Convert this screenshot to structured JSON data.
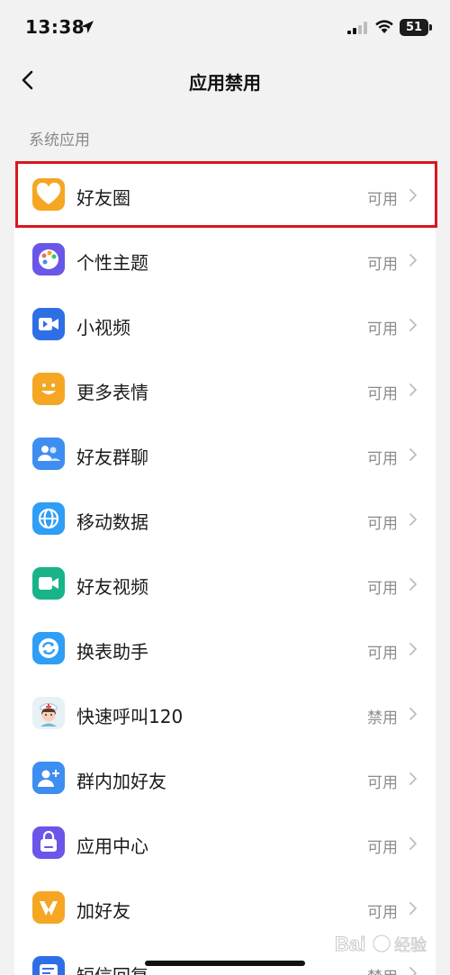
{
  "status_bar": {
    "time": "13:38",
    "battery": "51"
  },
  "nav": {
    "title": "应用禁用"
  },
  "section": {
    "header": "系统应用"
  },
  "apps": [
    {
      "name": "好友圈",
      "status": "可用",
      "icon": "heart-icon",
      "color": "#f5a623"
    },
    {
      "name": "个性主题",
      "status": "可用",
      "icon": "palette-icon",
      "color": "#6a56e8"
    },
    {
      "name": "小视频",
      "status": "可用",
      "icon": "video-camera-icon",
      "color": "#2f6fe6"
    },
    {
      "name": "更多表情",
      "status": "可用",
      "icon": "smiley-icon",
      "color": "#f5a623"
    },
    {
      "name": "好友群聊",
      "status": "可用",
      "icon": "group-chat-icon",
      "color": "#3d8ef0"
    },
    {
      "name": "移动数据",
      "status": "可用",
      "icon": "globe-icon",
      "color": "#2f9ef5"
    },
    {
      "name": "好友视频",
      "status": "可用",
      "icon": "video-call-icon",
      "color": "#19b38a"
    },
    {
      "name": "换表助手",
      "status": "可用",
      "icon": "sync-icon",
      "color": "#2f9ef5"
    },
    {
      "name": "快速呼叫120",
      "status": "禁用",
      "icon": "nurse-icon",
      "color": "#e7f1f6"
    },
    {
      "name": "群内加好友",
      "status": "可用",
      "icon": "add-friend-icon",
      "color": "#3d8ef0"
    },
    {
      "name": "应用中心",
      "status": "可用",
      "icon": "shopping-bag-icon",
      "color": "#6a56e8"
    },
    {
      "name": "加好友",
      "status": "可用",
      "icon": "handshake-icon",
      "color": "#f5a623"
    },
    {
      "name": "短信回复",
      "status": "禁用",
      "icon": "message-icon",
      "color": "#2f6fe6"
    }
  ],
  "watermark": {
    "text": "Bai 经验"
  }
}
